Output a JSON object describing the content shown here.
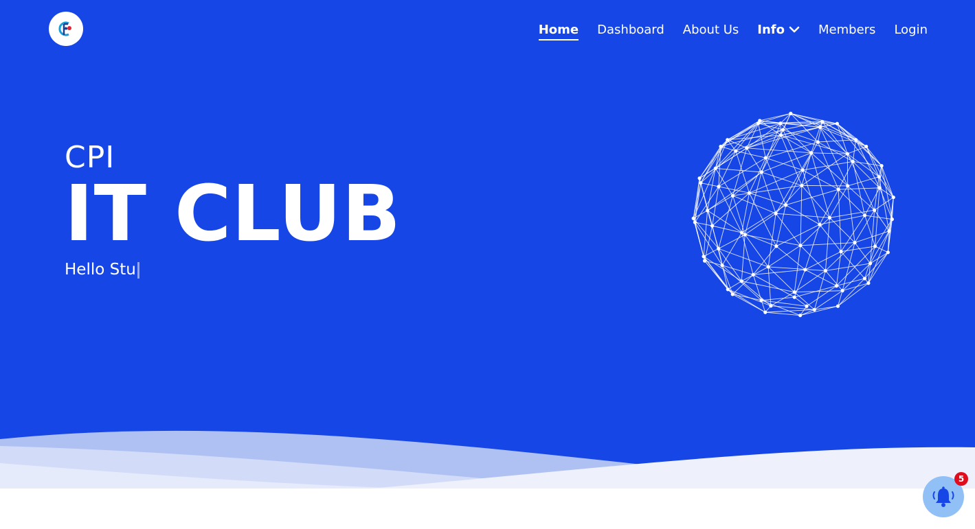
{
  "nav": {
    "items": [
      {
        "label": "Home"
      },
      {
        "label": "Dashboard"
      },
      {
        "label": "About Us"
      },
      {
        "label": "Info"
      },
      {
        "label": "Members"
      },
      {
        "label": "Login"
      }
    ]
  },
  "hero": {
    "pre_title": "CPI",
    "title": "IT CLUB",
    "typed_text": "Hello Stu"
  },
  "notifications": {
    "count": "5"
  },
  "icons": {
    "logo": "cpi-it-club-logo",
    "dropdown": "chevron-down-icon",
    "bell": "bell-icon",
    "globe": "network-globe"
  },
  "colors": {
    "hero_bg": "#1746e6",
    "text": "#ffffff",
    "badge": "#e00d1f",
    "bell_bg": "#90c0f5"
  }
}
